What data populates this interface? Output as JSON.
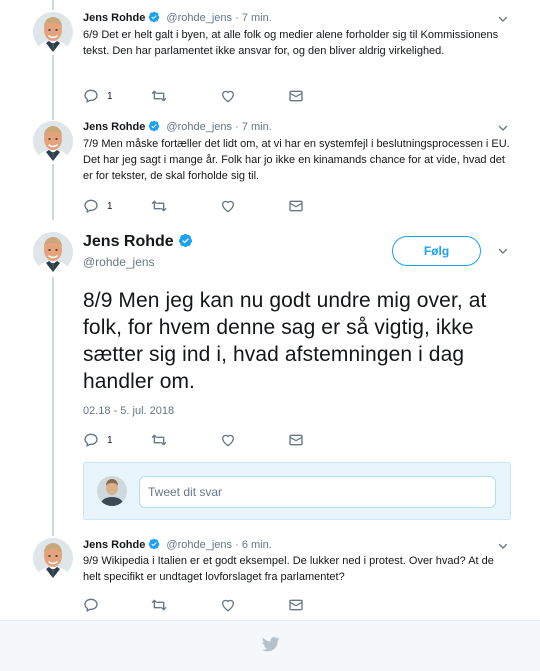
{
  "colors": {
    "accent": "#1da1f2",
    "secondary_text": "#657786",
    "thread_line": "#ccd6dd",
    "icon": "#657786"
  },
  "author": {
    "name": "Jens Rohde",
    "handle": "@rohde_jens"
  },
  "tweets": [
    {
      "name": "Jens Rohde",
      "handle": "@rohde_jens",
      "separator": "·",
      "time": "7 min.",
      "text": "6/9 Det er helt galt i byen, at alle folk og medier alene forholder sig til Kommissionens tekst. Den har parlamentet ikke ansvar for, og den bliver aldrig virkelighed.",
      "reply_count": "1"
    },
    {
      "name": "Jens Rohde",
      "handle": "@rohde_jens",
      "separator": "·",
      "time": "7 min.",
      "text": "7/9 Men måske fortæller det lidt om, at vi har en systemfejl i beslutningsprocessen i EU. Det har jeg sagt i mange år. Folk har jo ikke en kinamands chance for at vide, hvad det er for tekster, de skal forholde sig til.",
      "reply_count": "1"
    }
  ],
  "focused": {
    "name": "Jens Rohde",
    "handle": "@rohde_jens",
    "follow_label": "Følg",
    "text": "8/9 Men jeg kan nu godt undre mig over, at folk, for hvem denne sag er så vigtig, ikke sætter sig ind i, hvad afstemningen i dag handler om.",
    "timestamp": "02.18 - 5. jul. 2018",
    "reply_count": "1",
    "reply_placeholder": "Tweet dit svar"
  },
  "last_tweet": {
    "name": "Jens Rohde",
    "handle": "@rohde_jens",
    "separator": "·",
    "time": "6 min.",
    "text": "9/9 Wikipedia i Italien er et godt eksempel. De lukker ned i protest. Over hvad? At de helt specifikt er undtaget lovforslaget fra parlamentet?"
  },
  "icons": {
    "verified": "verified-badge-icon",
    "reply": "reply-icon",
    "retweet": "retweet-icon",
    "like": "heart-icon",
    "dm": "envelope-icon",
    "caret": "chevron-down-icon",
    "logo": "twitter-bird-icon"
  }
}
